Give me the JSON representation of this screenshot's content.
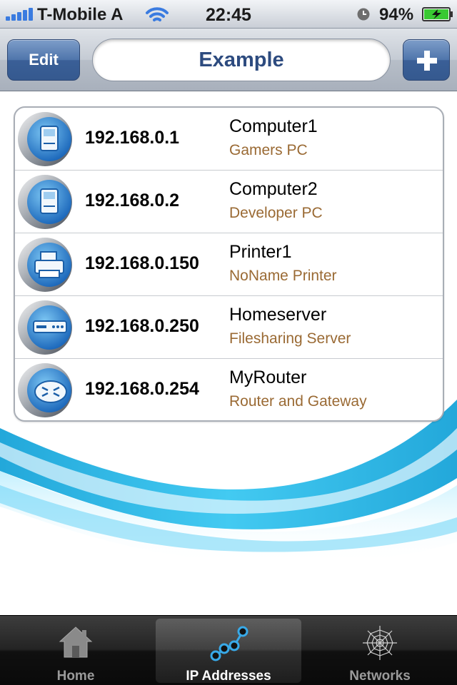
{
  "status_bar": {
    "carrier": "T-Mobile A",
    "time": "22:45",
    "battery_percent": "94%",
    "icons": [
      "signal-icon",
      "wifi-icon",
      "alarm-icon",
      "battery-charging-icon"
    ]
  },
  "nav": {
    "edit_label": "Edit",
    "title": "Example",
    "add_icon": "plus-icon"
  },
  "devices": [
    {
      "ip": "192.168.0.1",
      "name": "Computer1",
      "description": "Gamers PC",
      "icon": "computer-icon"
    },
    {
      "ip": "192.168.0.2",
      "name": "Computer2",
      "description": "Developer PC",
      "icon": "computer-icon"
    },
    {
      "ip": "192.168.0.150",
      "name": "Printer1",
      "description": "NoName Printer",
      "icon": "printer-icon"
    },
    {
      "ip": "192.168.0.250",
      "name": "Homeserver",
      "description": "Filesharing Server",
      "icon": "server-icon"
    },
    {
      "ip": "192.168.0.254",
      "name": "MyRouter",
      "description": "Router and Gateway",
      "icon": "router-icon"
    }
  ],
  "tabs": [
    {
      "label": "Home",
      "icon": "home-icon",
      "active": false
    },
    {
      "label": "IP Addresses",
      "icon": "ip-nodes-icon",
      "active": true
    },
    {
      "label": "Networks",
      "icon": "web-icon",
      "active": false
    }
  ],
  "colors": {
    "accent": "#3a5f97",
    "title_text": "#2d4b7f",
    "description_text": "#9a6a34",
    "swoosh": "#1cb4e8"
  }
}
